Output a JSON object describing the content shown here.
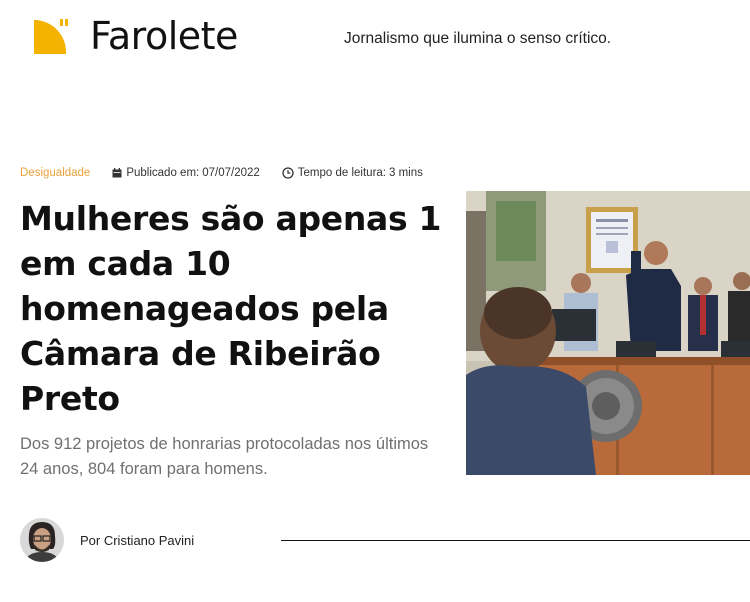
{
  "brand": {
    "name": "Farolete",
    "tagline": "Jornalismo que ilumina o senso crítico.",
    "accent_color": "#f5b301"
  },
  "article": {
    "category": "Desigualdade",
    "category_color": "#e9a23b",
    "published_label": "Publicado em:",
    "published_date": "07/07/2022",
    "reading_label": "Tempo de leitura:",
    "reading_time": "3 mins",
    "title": "Mulheres são apenas 1 em cada 10 homenageados pela Câmara de Ribeirão Preto",
    "subtitle": "Dos 912 projetos de honrarias protocoladas nos últimos 24 anos, 804 foram para homens.",
    "author": "Por Cristiano Pavini"
  },
  "icons": {
    "logo": "farolete-logo-icon",
    "calendar": "calendar-icon",
    "clock": "clock-icon"
  }
}
